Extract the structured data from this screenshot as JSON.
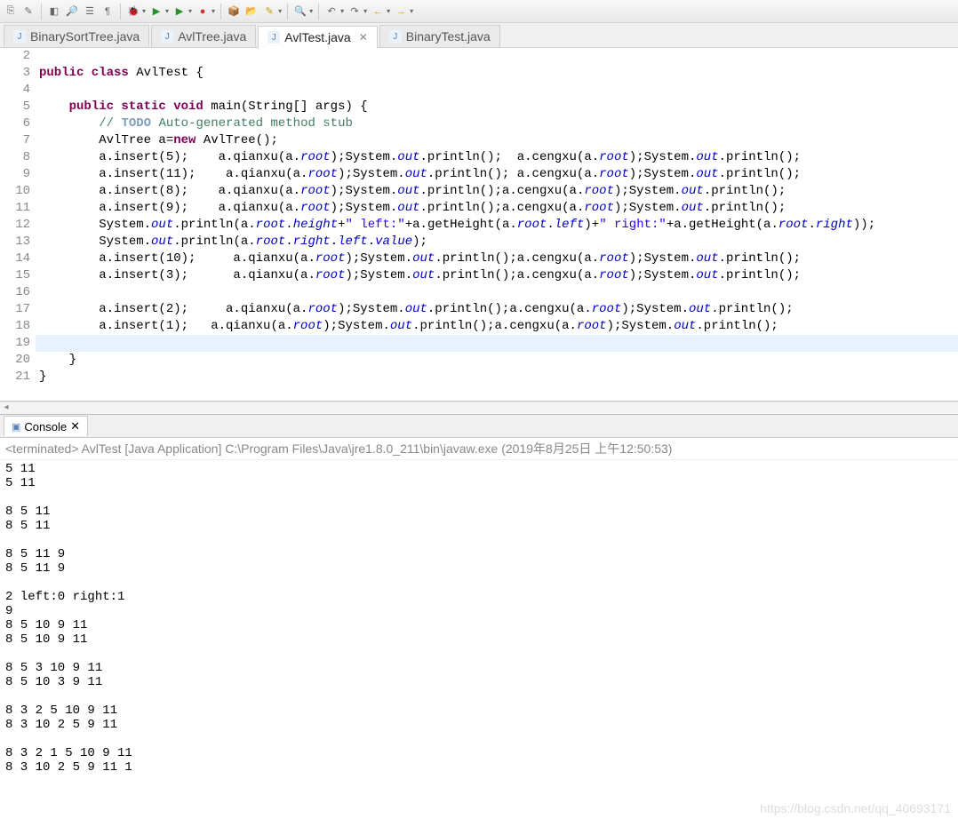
{
  "toolbar_icons": [
    "📄",
    "✏",
    "⬜",
    "🔍",
    "📑",
    "¶",
    "⚙",
    "▶",
    "🐞",
    "▶",
    "🔴",
    "📦",
    "📂",
    "🔧",
    "🔍",
    "←",
    "→",
    "←",
    "→"
  ],
  "tabs": [
    {
      "label": "BinarySortTree.java",
      "active": false,
      "closable": false
    },
    {
      "label": "AvlTree.java",
      "active": false,
      "closable": false
    },
    {
      "label": "AvlTest.java",
      "active": true,
      "closable": true
    },
    {
      "label": "BinaryTest.java",
      "active": false,
      "closable": false
    }
  ],
  "code": {
    "lines": [
      {
        "n": 2,
        "html": ""
      },
      {
        "n": 3,
        "html": "<span class='kw'>public class</span> AvlTest {"
      },
      {
        "n": 4,
        "html": ""
      },
      {
        "n": 5,
        "html": "    <span class='kw'>public static void</span> main(String[] args) {"
      },
      {
        "n": 6,
        "html": "        <span class='cm'>// <span class='todo'>TODO</span> Auto-generated method stub</span>"
      },
      {
        "n": 7,
        "html": "        AvlTree a=<span class='kw'>new</span> AvlTree();"
      },
      {
        "n": 8,
        "html": "        a.insert(5);    a.qianxu(a.<span class='fld'>root</span>);System.<span class='fld'>out</span>.println();  a.cengxu(a.<span class='fld'>root</span>);System.<span class='fld'>out</span>.println();"
      },
      {
        "n": 9,
        "html": "        a.insert(11);    a.qianxu(a.<span class='fld'>root</span>);System.<span class='fld'>out</span>.println(); a.cengxu(a.<span class='fld'>root</span>);System.<span class='fld'>out</span>.println();"
      },
      {
        "n": 10,
        "html": "        a.insert(8);    a.qianxu(a.<span class='fld'>root</span>);System.<span class='fld'>out</span>.println();a.cengxu(a.<span class='fld'>root</span>);System.<span class='fld'>out</span>.println();"
      },
      {
        "n": 11,
        "html": "        a.insert(9);    a.qianxu(a.<span class='fld'>root</span>);System.<span class='fld'>out</span>.println();a.cengxu(a.<span class='fld'>root</span>);System.<span class='fld'>out</span>.println();"
      },
      {
        "n": 12,
        "html": "        System.<span class='fld'>out</span>.println(a.<span class='fld'>root</span>.<span class='fld'>height</span>+<span class='str'>\" left:\"</span>+a.getHeight(a.<span class='fld'>root</span>.<span class='fld'>left</span>)+<span class='str'>\" right:\"</span>+a.getHeight(a.<span class='fld'>root</span>.<span class='fld'>right</span>));"
      },
      {
        "n": 13,
        "html": "        System.<span class='fld'>out</span>.println(a.<span class='fld'>root</span>.<span class='fld'>right</span>.<span class='fld'>left</span>.<span class='fld'>value</span>);"
      },
      {
        "n": 14,
        "html": "        a.insert(10);     a.qianxu(a.<span class='fld'>root</span>);System.<span class='fld'>out</span>.println();a.cengxu(a.<span class='fld'>root</span>);System.<span class='fld'>out</span>.println();"
      },
      {
        "n": 15,
        "html": "        a.insert(3);      a.qianxu(a.<span class='fld'>root</span>);System.<span class='fld'>out</span>.println();a.cengxu(a.<span class='fld'>root</span>);System.<span class='fld'>out</span>.println();"
      },
      {
        "n": 16,
        "html": ""
      },
      {
        "n": 17,
        "html": "        a.insert(2);     a.qianxu(a.<span class='fld'>root</span>);System.<span class='fld'>out</span>.println();a.cengxu(a.<span class='fld'>root</span>);System.<span class='fld'>out</span>.println();"
      },
      {
        "n": 18,
        "html": "        a.insert(1);   a.qianxu(a.<span class='fld'>root</span>);System.<span class='fld'>out</span>.println();a.cengxu(a.<span class='fld'>root</span>);System.<span class='fld'>out</span>.println();"
      },
      {
        "n": 19,
        "html": "",
        "hl": true
      },
      {
        "n": 20,
        "html": "    }"
      },
      {
        "n": 21,
        "html": "}"
      }
    ]
  },
  "console": {
    "tab_label": "Console",
    "header": "<terminated> AvlTest [Java Application] C:\\Program Files\\Java\\jre1.8.0_211\\bin\\javaw.exe (2019年8月25日 上午12:50:53)",
    "output": "5 11\n5 11\n\n8 5 11\n8 5 11\n\n8 5 11 9\n8 5 11 9\n\n2 left:0 right:1\n9\n8 5 10 9 11\n8 5 10 9 11\n\n8 5 3 10 9 11\n8 5 10 3 9 11\n\n8 3 2 5 10 9 11\n8 3 10 2 5 9 11\n\n8 3 2 1 5 10 9 11\n8 3 10 2 5 9 11 1"
  },
  "watermark": "https://blog.csdn.net/qq_40693171"
}
